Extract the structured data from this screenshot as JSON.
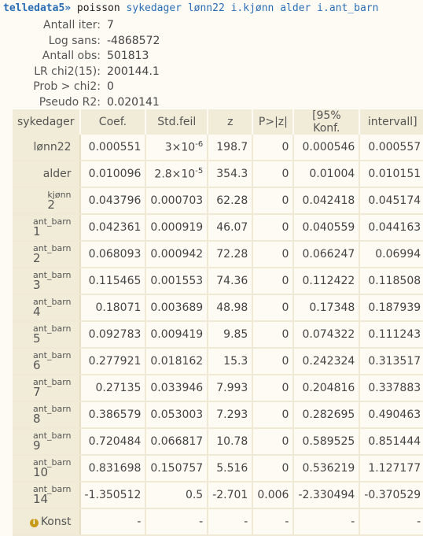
{
  "command": {
    "prompt": "telledata5»",
    "keyword": "poisson",
    "args": "sykedager lønn22 i.kjønn alder i.ant_barn"
  },
  "stats": [
    {
      "label": "Antall iter:",
      "value": "7"
    },
    {
      "label": "Log sans:",
      "value": "-4868572"
    },
    {
      "label": "Antall obs:",
      "value": "501813"
    },
    {
      "label": "LR chi2(15):",
      "value": "200144.1"
    },
    {
      "label": "Prob > chi2:",
      "value": "0"
    },
    {
      "label": "Pseudo R2:",
      "value": "0.020141"
    }
  ],
  "table": {
    "headers": [
      "sykedager",
      "Coef.",
      "Std.feil",
      "z",
      "P>|z|",
      "[95% Konf.",
      "intervall]"
    ],
    "rows": [
      {
        "top": "",
        "name": "lønn22",
        "coef": "0.000551",
        "se_mant": "3×10",
        "se_exp": "-6",
        "z": "198.7",
        "p": "0",
        "lo": "0.000546",
        "hi": "0.000557"
      },
      {
        "top": "",
        "name": "alder",
        "coef": "0.010096",
        "se_mant": "2.8×10",
        "se_exp": "-5",
        "z": "354.3",
        "p": "0",
        "lo": "0.01004",
        "hi": "0.010151"
      },
      {
        "top": "kjønn",
        "name": "2",
        "coef": "0.043796",
        "se": "0.000703",
        "z": "62.28",
        "p": "0",
        "lo": "0.042418",
        "hi": "0.045174"
      },
      {
        "top": "ant_barn",
        "name": "1",
        "coef": "0.042361",
        "se": "0.000919",
        "z": "46.07",
        "p": "0",
        "lo": "0.040559",
        "hi": "0.044163"
      },
      {
        "top": "ant_barn",
        "name": "2",
        "coef": "0.068093",
        "se": "0.000942",
        "z": "72.28",
        "p": "0",
        "lo": "0.066247",
        "hi": "0.06994"
      },
      {
        "top": "ant_barn",
        "name": "3",
        "coef": "0.115465",
        "se": "0.001553",
        "z": "74.36",
        "p": "0",
        "lo": "0.112422",
        "hi": "0.118508"
      },
      {
        "top": "ant_barn",
        "name": "4",
        "coef": "0.18071",
        "se": "0.003689",
        "z": "48.98",
        "p": "0",
        "lo": "0.17348",
        "hi": "0.187939"
      },
      {
        "top": "ant_barn",
        "name": "5",
        "coef": "0.092783",
        "se": "0.009419",
        "z": "9.85",
        "p": "0",
        "lo": "0.074322",
        "hi": "0.111243"
      },
      {
        "top": "ant_barn",
        "name": "6",
        "coef": "0.277921",
        "se": "0.018162",
        "z": "15.3",
        "p": "0",
        "lo": "0.242324",
        "hi": "0.313517"
      },
      {
        "top": "ant_barn",
        "name": "7",
        "coef": "0.27135",
        "se": "0.033946",
        "z": "7.993",
        "p": "0",
        "lo": "0.204816",
        "hi": "0.337883"
      },
      {
        "top": "ant_barn",
        "name": "8",
        "coef": "0.386579",
        "se": "0.053003",
        "z": "7.293",
        "p": "0",
        "lo": "0.282695",
        "hi": "0.490463"
      },
      {
        "top": "ant_barn",
        "name": "9",
        "coef": "0.720484",
        "se": "0.066817",
        "z": "10.78",
        "p": "0",
        "lo": "0.589525",
        "hi": "0.851444"
      },
      {
        "top": "ant_barn",
        "name": "10",
        "coef": "0.831698",
        "se": "0.150757",
        "z": "5.516",
        "p": "0",
        "lo": "0.536219",
        "hi": "1.127177"
      },
      {
        "top": "ant_barn",
        "name": "14",
        "coef": "-1.350512",
        "se": "0.5",
        "z": "-2.701",
        "p": "0.006",
        "lo": "-2.330494",
        "hi": "-0.370529"
      },
      {
        "top": "",
        "name": "Konst",
        "icon": "info-icon",
        "coef": "-",
        "se": "-",
        "z": "-",
        "p": "-",
        "lo": "-",
        "hi": "-"
      }
    ]
  }
}
